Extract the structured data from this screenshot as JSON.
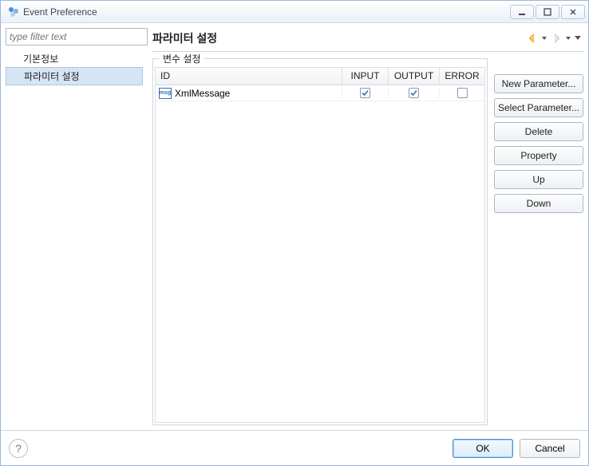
{
  "window": {
    "title": "Event Preference"
  },
  "sidebar": {
    "filter_placeholder": "type filter text",
    "items": [
      {
        "label": "기본정보",
        "selected": false
      },
      {
        "label": "파라미터 설정",
        "selected": true
      }
    ]
  },
  "content": {
    "heading": "파라미터 설정",
    "group_label": "변수 설정",
    "columns": {
      "id": "ID",
      "input": "INPUT",
      "output": "OUTPUT",
      "error": "ERROR"
    },
    "rows": [
      {
        "icon": "msg",
        "id": "XmlMessage",
        "input": true,
        "output": true,
        "error": false
      }
    ],
    "buttons": {
      "new_parameter": "New Parameter...",
      "select_parameter": "Select Parameter...",
      "delete": "Delete",
      "property": "Property",
      "up": "Up",
      "down": "Down"
    }
  },
  "footer": {
    "ok": "OK",
    "cancel": "Cancel"
  }
}
